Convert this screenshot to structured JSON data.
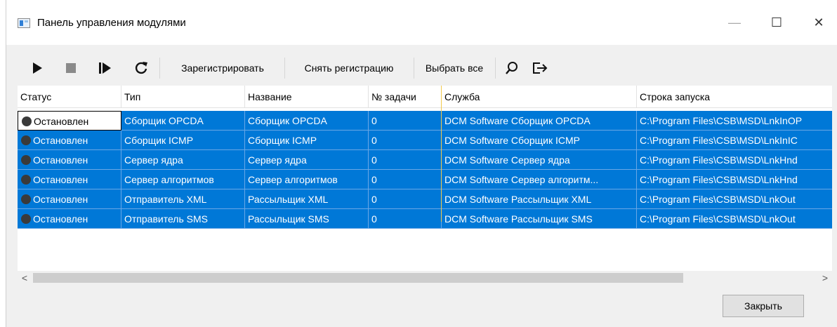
{
  "window": {
    "title": "Панель управления модулями",
    "controls": {
      "minimize": "—",
      "maximize": "☐",
      "close": "✕"
    }
  },
  "toolbar": {
    "icons": [
      "play-icon",
      "stop-icon",
      "step-icon",
      "refresh-icon"
    ],
    "register_label": "Зарегистрировать",
    "unregister_label": "Снять регистрацию",
    "select_all_label": "Выбрать все",
    "extra_icons": [
      "search-icon",
      "export-icon"
    ]
  },
  "table": {
    "columns": [
      "Статус",
      "Тип",
      "Название",
      "№ задачи",
      "Служба",
      "Строка запуска"
    ],
    "rows": [
      {
        "status": "Остановлен",
        "type": "Сборщик OPCDA",
        "name": "Сборщик OPCDA",
        "task": "0",
        "service": "DCM Software Сборщик OPCDA",
        "cmd": "C:\\Program Files\\CSB\\MSD\\LnkInOP"
      },
      {
        "status": "Остановлен",
        "type": "Сборщик ICMP",
        "name": "Сборщик ICMP",
        "task": "0",
        "service": "DCM Software Сборщик ICMP",
        "cmd": "C:\\Program Files\\CSB\\MSD\\LnkInIC"
      },
      {
        "status": "Остановлен",
        "type": "Сервер ядра",
        "name": "Сервер ядра",
        "task": "0",
        "service": "DCM Software Сервер ядра",
        "cmd": "C:\\Program Files\\CSB\\MSD\\LnkHnd"
      },
      {
        "status": "Остановлен",
        "type": "Сервер алгоритмов",
        "name": "Сервер алгоритмов",
        "task": "0",
        "service": "DCM Software Сервер алгоритм...",
        "cmd": "C:\\Program Files\\CSB\\MSD\\LnkHnd"
      },
      {
        "status": "Остановлен",
        "type": "Отправитель XML",
        "name": "Рассыльщик XML",
        "task": "0",
        "service": "DCM Software Рассыльщик XML",
        "cmd": "C:\\Program Files\\CSB\\MSD\\LnkOut"
      },
      {
        "status": "Остановлен",
        "type": "Отправитель SMS",
        "name": "Рассыльщик SMS",
        "task": "0",
        "service": "DCM Software Рассыльщик SMS",
        "cmd": "C:\\Program Files\\CSB\\MSD\\LnkOut"
      }
    ],
    "selection_color": "#0078d7",
    "status_dot_color": "#3a3a3a"
  },
  "scrollbar": {
    "left_arrow": "<",
    "right_arrow": ">"
  },
  "footer": {
    "close_label": "Закрыть"
  }
}
